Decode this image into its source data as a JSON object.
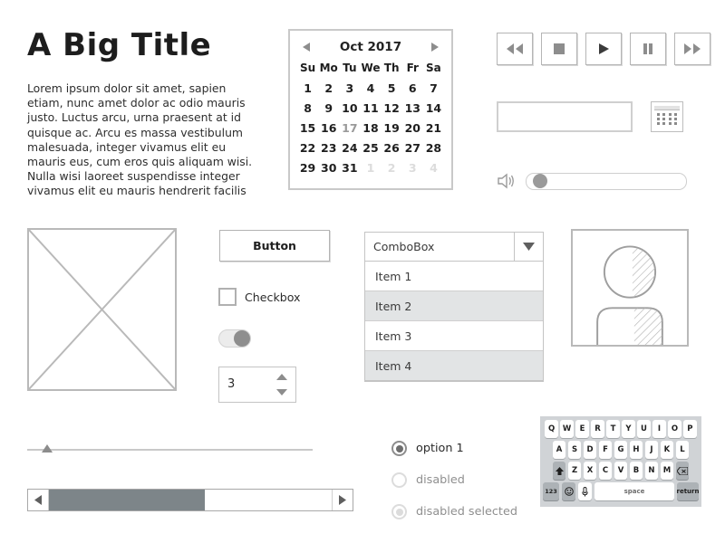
{
  "page": {
    "title": "A Big Title",
    "paragraph": "Lorem ipsum dolor sit amet, sapien etiam, nunc amet dolor ac odio mauris justo. Luctus arcu, urna praesent at id quisque ac. Arcu es massa vestibulum malesuada, integer vivamus elit eu mauris eus, cum eros quis aliquam wisi. Nulla wisi laoreet suspendisse integer vivamus elit eu mauris hendrerit facilis"
  },
  "calendar": {
    "icon_prev": "triangle-left-icon",
    "icon_next": "triangle-right-icon",
    "month_label": "Oct  2017",
    "weekdays": [
      "Su",
      "Mo",
      "Tu",
      "We",
      "Th",
      "Fr",
      "Sa"
    ],
    "cells": [
      {
        "d": "1",
        "state": "normal"
      },
      {
        "d": "2",
        "state": "normal"
      },
      {
        "d": "3",
        "state": "normal"
      },
      {
        "d": "4",
        "state": "normal"
      },
      {
        "d": "5",
        "state": "normal"
      },
      {
        "d": "6",
        "state": "normal"
      },
      {
        "d": "7",
        "state": "normal"
      },
      {
        "d": "8",
        "state": "normal"
      },
      {
        "d": "9",
        "state": "normal"
      },
      {
        "d": "10",
        "state": "normal"
      },
      {
        "d": "11",
        "state": "normal"
      },
      {
        "d": "12",
        "state": "normal"
      },
      {
        "d": "13",
        "state": "normal"
      },
      {
        "d": "14",
        "state": "normal"
      },
      {
        "d": "15",
        "state": "normal"
      },
      {
        "d": "16",
        "state": "normal"
      },
      {
        "d": "17",
        "state": "selected"
      },
      {
        "d": "18",
        "state": "normal"
      },
      {
        "d": "19",
        "state": "normal"
      },
      {
        "d": "20",
        "state": "normal"
      },
      {
        "d": "21",
        "state": "normal"
      },
      {
        "d": "22",
        "state": "normal"
      },
      {
        "d": "23",
        "state": "normal"
      },
      {
        "d": "24",
        "state": "normal"
      },
      {
        "d": "25",
        "state": "normal"
      },
      {
        "d": "26",
        "state": "normal"
      },
      {
        "d": "27",
        "state": "normal"
      },
      {
        "d": "28",
        "state": "normal"
      },
      {
        "d": "29",
        "state": "normal"
      },
      {
        "d": "30",
        "state": "normal"
      },
      {
        "d": "31",
        "state": "normal"
      },
      {
        "d": "1",
        "state": "muted"
      },
      {
        "d": "2",
        "state": "muted"
      },
      {
        "d": "3",
        "state": "muted"
      },
      {
        "d": "4",
        "state": "muted"
      }
    ]
  },
  "media_controls": [
    {
      "name": "rewind-button",
      "icon": "rewind-icon"
    },
    {
      "name": "stop-button",
      "icon": "stop-icon"
    },
    {
      "name": "play-button",
      "icon": "play-icon"
    },
    {
      "name": "pause-button",
      "icon": "pause-icon"
    },
    {
      "name": "fast-forward-button",
      "icon": "fast-forward-icon"
    }
  ],
  "text_field": {
    "value": "",
    "placeholder": ""
  },
  "date_picker_button": {
    "icon": "calendar-icon"
  },
  "volume": {
    "icon": "speaker-icon",
    "value_percent": 4
  },
  "image_placeholder": {
    "icon": "image-placeholder-icon"
  },
  "button": {
    "label": "Button"
  },
  "checkbox": {
    "label": "Checkbox",
    "checked": false
  },
  "toggle": {
    "state": "on"
  },
  "spinner": {
    "value": "3",
    "icon_up": "triangle-up-icon",
    "icon_down": "triangle-down-icon"
  },
  "combobox": {
    "value": "ComboBox",
    "arrow_icon": "chevron-down-icon",
    "items": [
      {
        "label": "Item 1",
        "highlight": false
      },
      {
        "label": "Item 2",
        "highlight": true
      },
      {
        "label": "Item 3",
        "highlight": false
      },
      {
        "label": "Item 4",
        "highlight": true
      }
    ]
  },
  "avatar": {
    "icon": "person-avatar-icon"
  },
  "slider": {
    "value_percent": 7,
    "marker_icon": "triangle-up-marker-icon"
  },
  "scrollbar": {
    "left_icon": "triangle-left-icon",
    "right_icon": "triangle-right-icon",
    "thumb_start_percent": 0,
    "thumb_width_percent": 55
  },
  "radios": [
    {
      "label": "option 1",
      "selected": true,
      "disabled": false
    },
    {
      "label": "disabled",
      "selected": false,
      "disabled": true
    },
    {
      "label": "disabled selected",
      "selected": true,
      "disabled": true
    }
  ],
  "keyboard": {
    "row1": [
      "Q",
      "W",
      "E",
      "R",
      "T",
      "Y",
      "U",
      "I",
      "O",
      "P"
    ],
    "row2": [
      "A",
      "S",
      "D",
      "F",
      "G",
      "H",
      "J",
      "K",
      "L"
    ],
    "row3_shift": "shift-icon",
    "row3": [
      "Z",
      "X",
      "C",
      "V",
      "B",
      "N",
      "M"
    ],
    "row3_backspace": "backspace-icon",
    "row4_numbers": "123",
    "row4_emoji": "emoji-icon",
    "row4_mic": "microphone-icon",
    "row4_space": "space",
    "row4_return": "return"
  },
  "colors": {
    "line": "#b9b9b9",
    "ink": "#2b2b2b",
    "muted": "#dcdcdc",
    "fill": "#8e8e8e",
    "keyboard_bg": "#d0d3d6",
    "highlight_row": "#e2e4e5"
  }
}
